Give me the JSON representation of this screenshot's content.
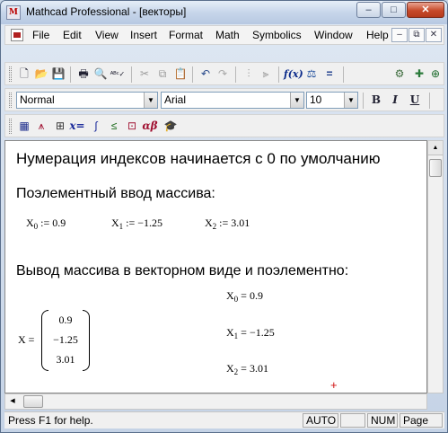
{
  "window": {
    "title": "Mathcad Professional - [векторы]",
    "controls": {
      "minimize": "–",
      "maximize": "□",
      "close": "✕"
    }
  },
  "menu": {
    "items": [
      "File",
      "Edit",
      "View",
      "Insert",
      "Format",
      "Math",
      "Symbolics",
      "Window",
      "Help"
    ],
    "mdi_controls": {
      "minimize": "–",
      "restore": "⧉",
      "close": "✕"
    }
  },
  "toolbar_standard": {
    "icons": [
      "new-icon",
      "open-icon",
      "save-icon",
      "print-icon",
      "print-preview-icon",
      "spell-check-icon",
      "cut-icon",
      "copy-icon",
      "paste-icon",
      "undo-icon",
      "redo-icon",
      "align-icon",
      "align-down-icon",
      "insert-function-icon",
      "insert-unit-icon",
      "calculate-icon",
      "component-icon",
      "resource-center-icon"
    ]
  },
  "toolbar_formatting": {
    "style": "Normal",
    "font": "Arial",
    "size": "10",
    "bold": "B",
    "italic": "I",
    "underline": "U"
  },
  "toolbar_math": {
    "icons": [
      "calculator-icon",
      "graph-icon",
      "matrix-icon",
      "evaluation-icon",
      "calculus-icon",
      "boolean-icon",
      "programming-icon",
      "greek-icon",
      "symbolic-icon"
    ]
  },
  "document": {
    "line1": "Нумерация индексов начинается с 0 по умолчанию",
    "heading1": "Поэлементный ввод массива:",
    "assignments": [
      {
        "var": "X",
        "sub": "0",
        "op": ":=",
        "value": "0.9"
      },
      {
        "var": "X",
        "sub": "1",
        "op": ":=",
        "value": "−1.25"
      },
      {
        "var": "X",
        "sub": "2",
        "op": ":=",
        "value": "3.01"
      }
    ],
    "heading2": "Вывод массива в векторном виде и поэлементно:",
    "vector": {
      "var": "X",
      "op": "=",
      "values": [
        "0.9",
        "−1.25",
        "3.01"
      ]
    },
    "results": [
      {
        "var": "X",
        "sub": "0",
        "op": "=",
        "value": "0.9"
      },
      {
        "var": "X",
        "sub": "1",
        "op": "=",
        "value": "−1.25"
      },
      {
        "var": "X",
        "sub": "2",
        "op": "=",
        "value": "3.01"
      }
    ],
    "cursor": "+"
  },
  "status": {
    "help": "Press F1 for help.",
    "auto": "AUTO",
    "num": "NUM",
    "page": "Page"
  }
}
